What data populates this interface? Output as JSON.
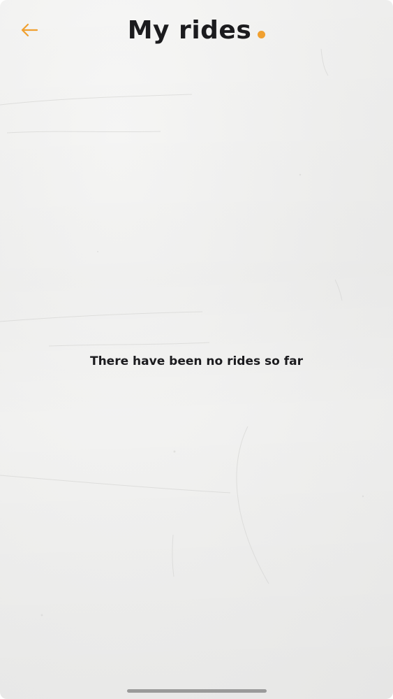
{
  "header": {
    "title": "My rides",
    "back_icon": "arrow-left-icon",
    "accent_color": "#f0a030"
  },
  "main": {
    "empty_message": "There have been no rides so far"
  }
}
